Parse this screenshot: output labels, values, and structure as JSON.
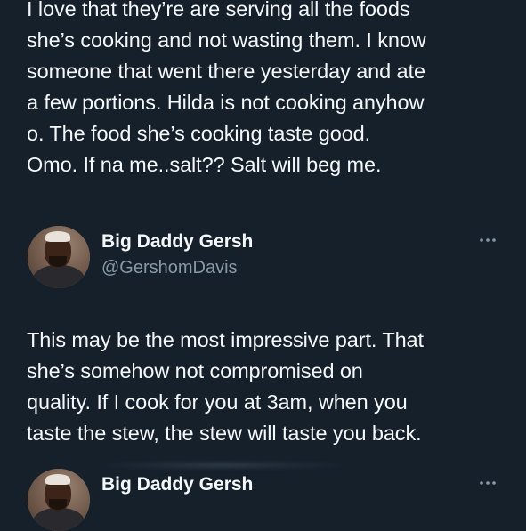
{
  "tweets": [
    {
      "text_lines": [
        "I love that they’re are serving all the foods",
        "she’s cooking and not wasting them. I know",
        "someone that went there yesterday and ate",
        "a few portions. Hilda is not cooking anyhow",
        "o. The food she’s cooking taste good.",
        "Omo. If na me..salt?? Salt will beg me."
      ]
    },
    {
      "author": {
        "name": "Big Daddy Gersh",
        "handle": "@GershomDavis"
      },
      "text_lines": [
        "This may be the most impressive part. That",
        "she’s somehow not compromised on",
        "quality. If I cook for you at 3am, when you",
        "taste the stew, the stew will taste you back."
      ]
    },
    {
      "author": {
        "name": "Big Daddy Gersh",
        "handle": ""
      }
    }
  ],
  "colors": {
    "background": "#15202b",
    "text": "#f5f8fa",
    "secondary": "#8899a6"
  },
  "icons": {
    "more": "more-horizontal-icon"
  }
}
